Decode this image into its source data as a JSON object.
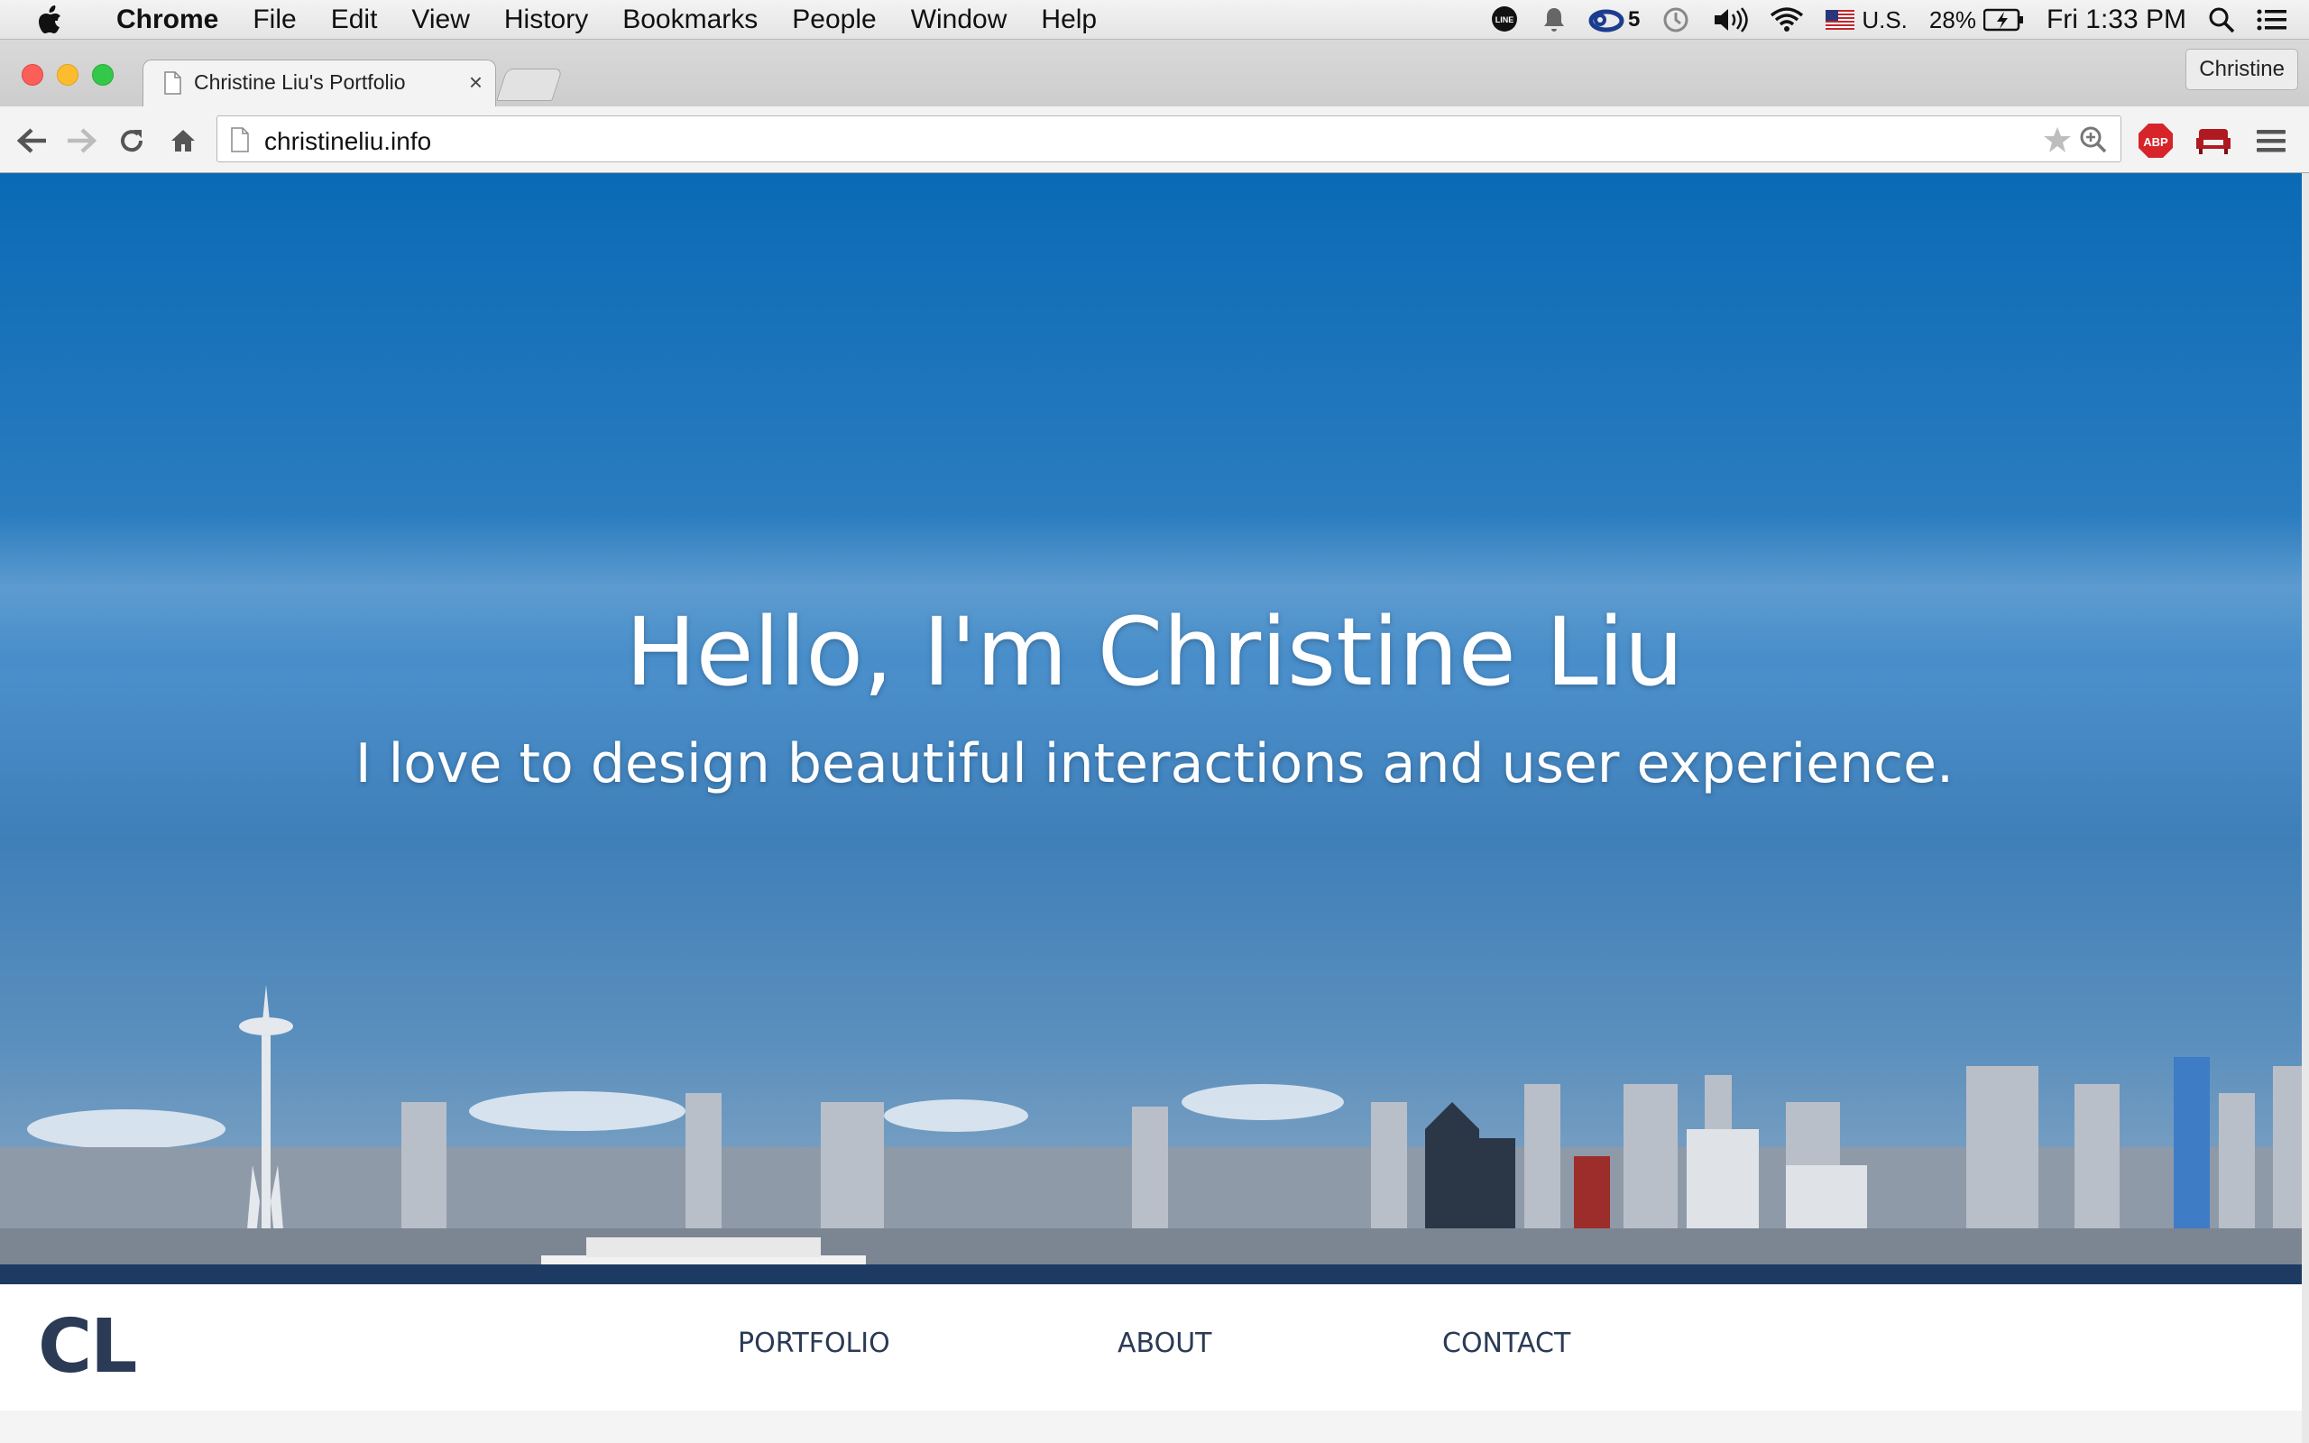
{
  "menubar": {
    "app": "Chrome",
    "items": [
      "File",
      "Edit",
      "View",
      "History",
      "Bookmarks",
      "People",
      "Window",
      "Help"
    ],
    "status": {
      "creative_cloud_count": "5",
      "input_source": "U.S.",
      "battery": "28%",
      "clock": "Fri 1:33 PM"
    },
    "icons": [
      "apple-icon",
      "line-icon",
      "notification-bell-icon",
      "creative-cloud-icon",
      "time-machine-icon",
      "volume-icon",
      "wifi-icon",
      "us-flag-icon",
      "battery-charging-icon",
      "spotlight-search-icon",
      "notification-center-icon"
    ]
  },
  "browser": {
    "tab_title": "Christine Liu's Portfolio",
    "tab_close": "×",
    "profile_name": "Christine",
    "url": "christineliu.info",
    "extensions": [
      "adblock-plus-icon",
      "sofa-icon"
    ],
    "accent_colors": {
      "abp": "#d6242a",
      "sofa": "#b0191f"
    }
  },
  "page": {
    "hero_title": "Hello, I'm Christine Liu",
    "hero_subtitle": "I love to design beautiful interactions and user experience.",
    "logo": "CL",
    "nav": [
      "PORTFOLIO",
      "ABOUT",
      "CONTACT"
    ],
    "colors": {
      "nav_text": "#2b3a55",
      "sky": "#0a6ab5"
    }
  }
}
